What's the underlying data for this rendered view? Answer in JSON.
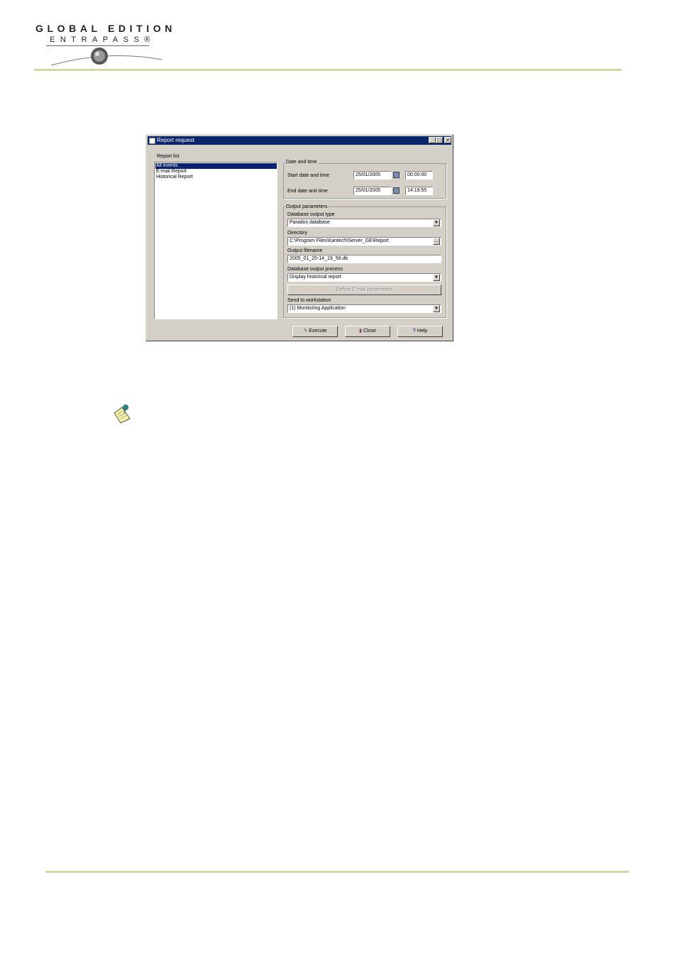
{
  "header": {
    "logo_line1": "GLOBAL EDITION",
    "logo_line2": "ENTRAPASS®"
  },
  "dialog": {
    "title": "Report request",
    "report_list_label": "Report list",
    "reports": [
      "All events",
      "E-mail Report",
      "Historical Report"
    ],
    "selected_report": "All events",
    "date_time": {
      "legend": "Date and time",
      "start_label": "Start date and time",
      "start_date": "25/01/2005",
      "start_time": "00:00:00",
      "end_label": "End date and time",
      "end_date": "25/01/2005",
      "end_time": "14:19:55"
    },
    "output": {
      "legend": "Output parameters",
      "db_type_label": "Database output type",
      "db_type_value": "Paradox database",
      "directory_label": "Directory",
      "directory_value": "C:\\Program Files\\Kantech\\Server_GE\\Report",
      "filename_label": "Output filename",
      "filename_value": "2005_01_25-14_19_58.db",
      "process_label": "Database output process",
      "process_value": "Display historical report",
      "email_button": "Define E-mail parameters",
      "workstation_label": "Send to workstation",
      "workstation_value": "(1) Monitoring Application"
    },
    "buttons": {
      "execute": "Execute",
      "close": "Close",
      "help": "Help"
    }
  }
}
